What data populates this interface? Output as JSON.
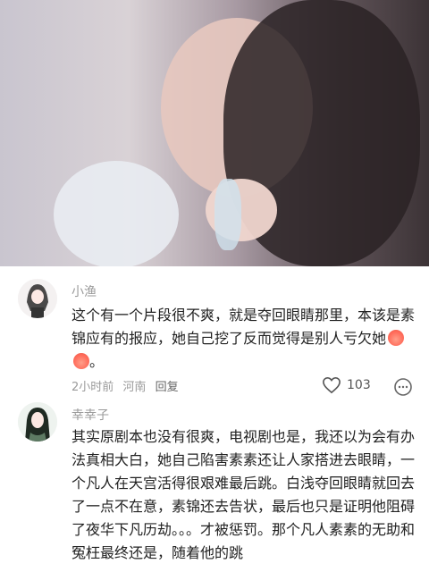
{
  "comments": [
    {
      "username": "小渔",
      "text": "这个有一个片段很不爽，就是夺回眼睛那里，本该是素锦应有的报应，她自己挖了反而觉得是别人亏欠她",
      "time": "2小时前",
      "location": "河南",
      "reply_label": "回复",
      "likes": "103"
    },
    {
      "username": "幸幸子",
      "text": "其实原剧本也没有很爽，电视剧也是，我还以为会有办法真相大白，她自己陷害素素还让人家搭进去眼睛，一个凡人在天宫活得很艰难最后跳。白浅夺回眼睛就回去了一点不在意，素锦还去告状，最后也只是证明他阻碍了夜华下凡历劫。。。才被惩罚。那个凡人素素的无助和冤枉最终还是，随着他的跳"
    }
  ],
  "icons": {
    "like": "heart-outline-icon",
    "more": "more-options-icon",
    "emoji": "peach-emoji-icon"
  }
}
